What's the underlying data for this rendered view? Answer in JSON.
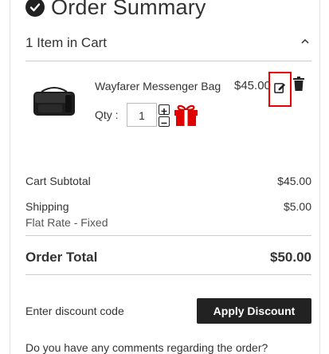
{
  "summary": {
    "title": "Order Summary"
  },
  "cart": {
    "items_label": "1 Item in Cart",
    "item": {
      "name": "Wayfarer Messenger Bag",
      "price": "$45.00",
      "qty_label": "Qty :",
      "qty_value": "1"
    }
  },
  "totals": {
    "subtotal_label": "Cart Subtotal",
    "subtotal_value": "$45.00",
    "shipping_label": "Shipping",
    "shipping_value": "$5.00",
    "shipping_method": "Flat Rate - Fixed",
    "order_total_label": "Order Total",
    "order_total_value": "$50.00"
  },
  "discount": {
    "placeholder": "Enter discount code",
    "apply_label": "Apply Discount"
  },
  "comments": {
    "prompt": "Do you have any comments regarding the order?"
  },
  "colors": {
    "accent_red": "#e00000",
    "dark": "#222222"
  }
}
